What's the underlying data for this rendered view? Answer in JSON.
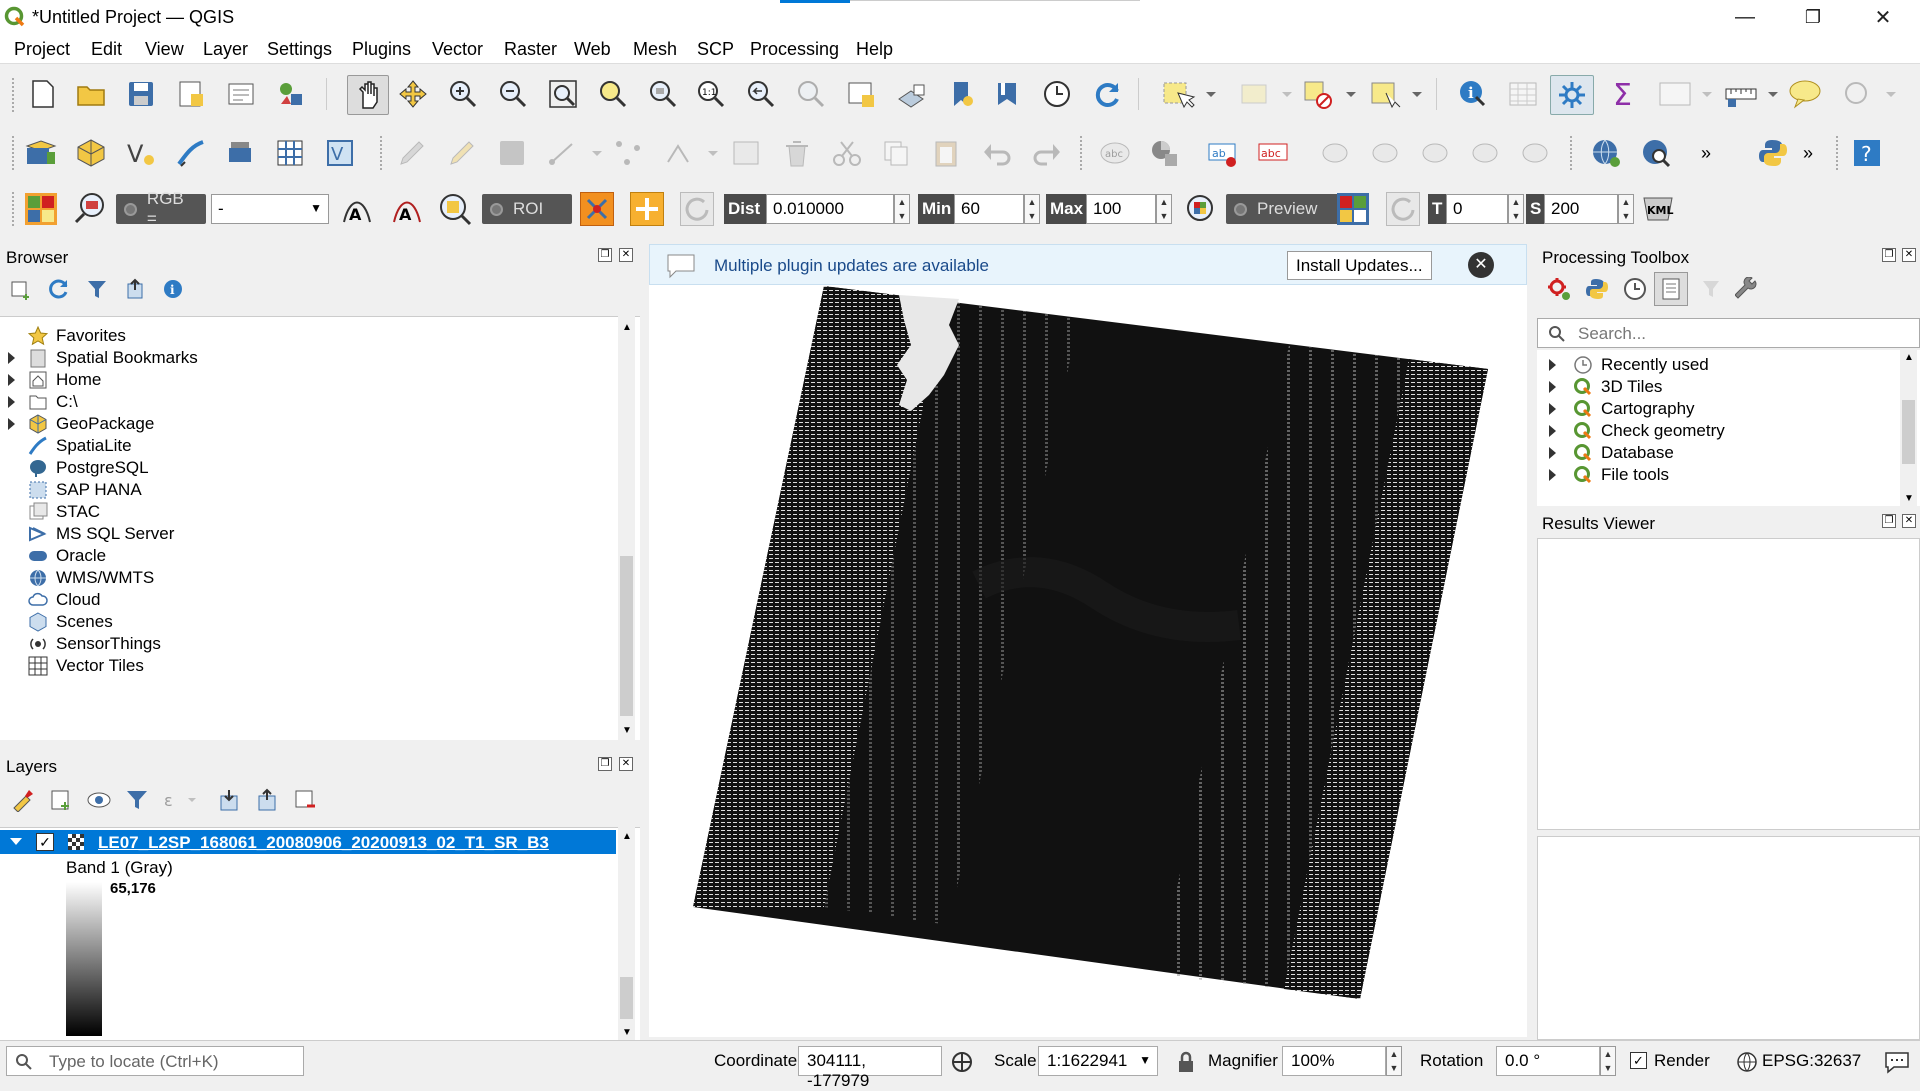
{
  "window": {
    "title": "*Untitled Project — QGIS",
    "minimize": "—",
    "restore": "❐",
    "close": "✕"
  },
  "menu": [
    "Project",
    "Edit",
    "View",
    "Layer",
    "Settings",
    "Plugins",
    "Vector",
    "Raster",
    "Web",
    "Mesh",
    "SCP",
    "Processing",
    "Help"
  ],
  "scp_toolbar": {
    "rgb_label": "RGB =",
    "rgb_value": "-",
    "roi_label": "ROI",
    "dist_label": "Dist",
    "dist_value": "0.010000",
    "min_label": "Min",
    "min_value": "60",
    "max_label": "Max",
    "max_value": "100",
    "preview_label": "Preview",
    "t_label": "T",
    "t_value": "0",
    "s_label": "S",
    "s_value": "200",
    "kml_label": "KML"
  },
  "browser": {
    "title": "Browser",
    "items": [
      {
        "label": "Favorites",
        "expandable": false,
        "icon": "star-icon"
      },
      {
        "label": "Spatial Bookmarks",
        "expandable": true,
        "icon": "bookmark-icon"
      },
      {
        "label": "Home",
        "expandable": true,
        "icon": "home-icon"
      },
      {
        "label": "C:\\",
        "expandable": true,
        "icon": "drive-icon"
      },
      {
        "label": "GeoPackage",
        "expandable": true,
        "icon": "geopackage-icon"
      },
      {
        "label": "SpatiaLite",
        "expandable": false,
        "icon": "spatialite-icon"
      },
      {
        "label": "PostgreSQL",
        "expandable": false,
        "icon": "postgresql-icon"
      },
      {
        "label": "SAP HANA",
        "expandable": false,
        "icon": "sap-hana-icon"
      },
      {
        "label": "STAC",
        "expandable": false,
        "icon": "stac-icon"
      },
      {
        "label": "MS SQL Server",
        "expandable": false,
        "icon": "mssql-icon"
      },
      {
        "label": "Oracle",
        "expandable": false,
        "icon": "oracle-icon"
      },
      {
        "label": "WMS/WMTS",
        "expandable": false,
        "icon": "wms-icon"
      },
      {
        "label": "Cloud",
        "expandable": false,
        "icon": "cloud-icon"
      },
      {
        "label": "Scenes",
        "expandable": false,
        "icon": "scenes-icon"
      },
      {
        "label": "SensorThings",
        "expandable": false,
        "icon": "sensorthings-icon"
      },
      {
        "label": "Vector Tiles",
        "expandable": false,
        "icon": "vector-tiles-icon"
      }
    ]
  },
  "layers": {
    "title": "Layers",
    "layer_name": "LE07_L2SP_168061_20080906_20200913_02_T1_SR_B3",
    "band_label": "Band 1 (Gray)",
    "max_value": "65,176",
    "checked": true
  },
  "message_bar": {
    "text": "Multiple plugin updates are available",
    "button": "Install Updates..."
  },
  "processing": {
    "title": "Processing Toolbox",
    "search_placeholder": "Search...",
    "items": [
      {
        "label": "Recently used",
        "icon": "clock-icon"
      },
      {
        "label": "3D Tiles",
        "icon": "qgis-icon"
      },
      {
        "label": "Cartography",
        "icon": "qgis-icon"
      },
      {
        "label": "Check geometry",
        "icon": "qgis-icon"
      },
      {
        "label": "Database",
        "icon": "qgis-icon"
      },
      {
        "label": "File tools",
        "icon": "qgis-icon"
      }
    ]
  },
  "results": {
    "title": "Results Viewer"
  },
  "statusbar": {
    "locator_placeholder": "Type to locate (Ctrl+K)",
    "coordinate_label": "Coordinate",
    "coordinate_value": "304111, -177979",
    "scale_label": "Scale",
    "scale_value": "1:1622941",
    "magnifier_label": "Magnifier",
    "magnifier_value": "100%",
    "rotation_label": "Rotation",
    "rotation_value": "0.0 °",
    "render_label": "Render",
    "render_checked": true,
    "crs_label": "EPSG:32637"
  },
  "colors": {
    "accent": "#0078d7",
    "selection": "#0078d7",
    "qgis_green": "#589632",
    "qgis_yellow": "#ee7913",
    "message_bg": "#e8f4fc"
  }
}
